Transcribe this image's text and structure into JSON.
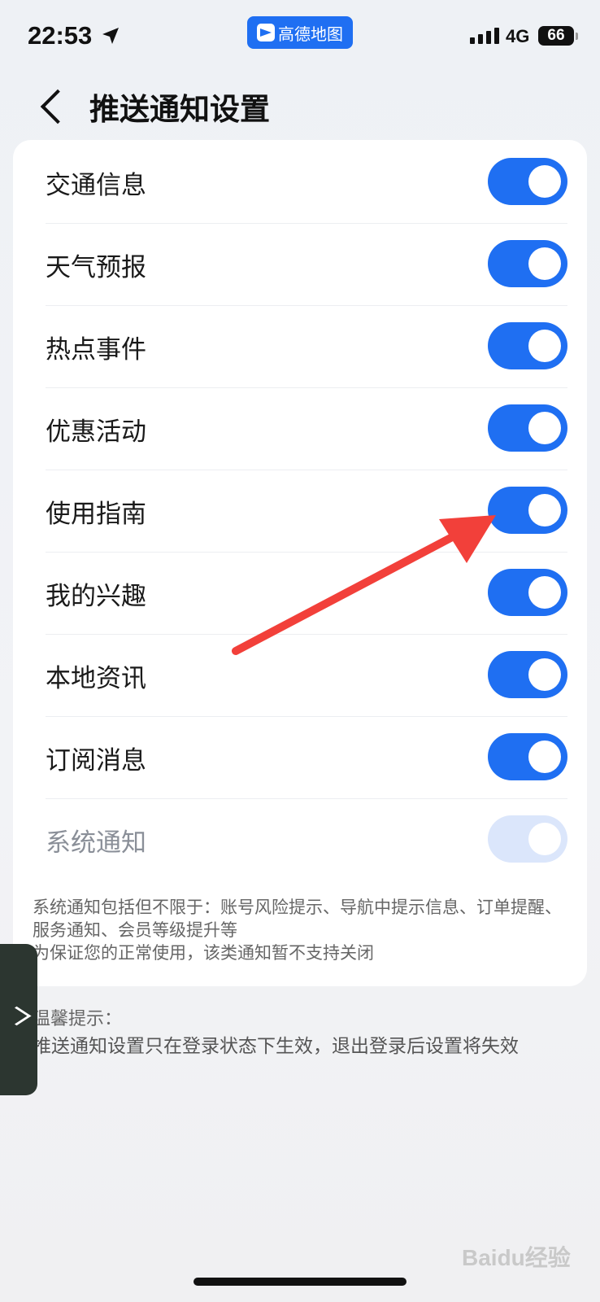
{
  "status_bar": {
    "time": "22:53",
    "app_name": "高德地图",
    "network": "4G",
    "battery": "66"
  },
  "header": {
    "title": "推送通知设置"
  },
  "settings": [
    {
      "label": "交通信息",
      "on": true
    },
    {
      "label": "天气预报",
      "on": true
    },
    {
      "label": "热点事件",
      "on": true
    },
    {
      "label": "优惠活动",
      "on": true
    },
    {
      "label": "使用指南",
      "on": true
    },
    {
      "label": "我的兴趣",
      "on": true
    },
    {
      "label": "本地资讯",
      "on": true
    },
    {
      "label": "订阅消息",
      "on": true
    },
    {
      "label": "系统通知",
      "on": true,
      "disabled": true
    }
  ],
  "system_note": {
    "line1": "系统通知包括但不限于：账号风险提示、导航中提示信息、订单提醒、服务通知、会员等级提升等",
    "line2": "为保证您的正常使用，该类通知暂不支持关闭"
  },
  "tips": {
    "title": "温馨提示：",
    "text": "推送通知设置只在登录状态下生效，退出登录后设置将失效"
  },
  "watermark": "Baidu经验",
  "colors": {
    "accent": "#1f6ff2",
    "toggle_disabled": "#dbe6fb",
    "annotation_arrow": "#f2403a"
  }
}
